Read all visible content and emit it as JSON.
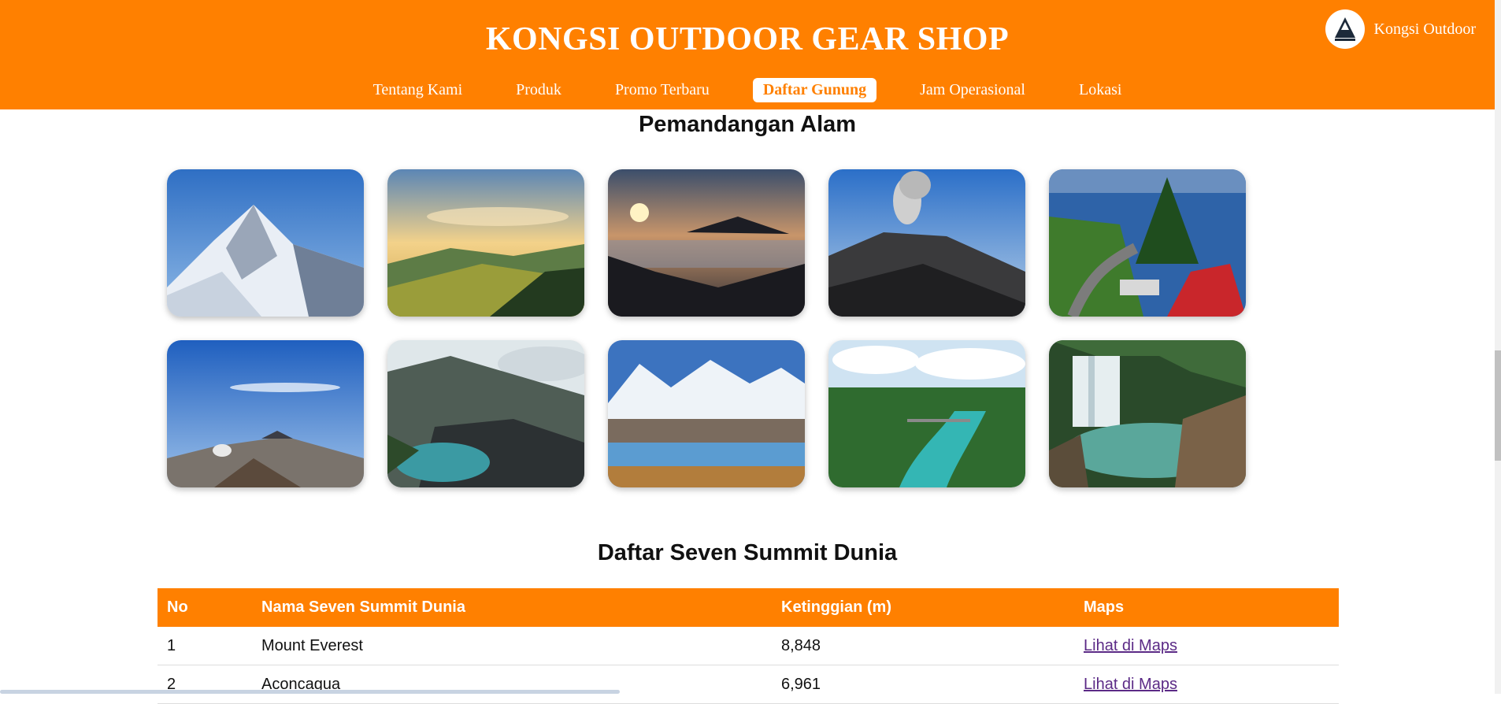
{
  "header": {
    "title": "KONGSI OUTDOOR GEAR SHOP",
    "nav": [
      {
        "label": "Tentang Kami",
        "active": false
      },
      {
        "label": "Produk",
        "active": false
      },
      {
        "label": "Promo Terbaru",
        "active": false
      },
      {
        "label": "Daftar Gunung",
        "active": true
      },
      {
        "label": "Jam Operasional",
        "active": false
      },
      {
        "label": "Lokasi",
        "active": false
      }
    ],
    "brand": {
      "name": "Kongsi Outdoor",
      "logo_icon": "mountain-logo-icon"
    }
  },
  "gallery": {
    "title": "Pemandangan Alam",
    "photos": [
      {
        "name": "snowy-peak-photo"
      },
      {
        "name": "sunrise-hills-photo"
      },
      {
        "name": "sunset-mountain-photo"
      },
      {
        "name": "volcano-smoke-photo"
      },
      {
        "name": "lake-road-photo"
      },
      {
        "name": "bromo-photo"
      },
      {
        "name": "crater-lake-photo"
      },
      {
        "name": "snow-range-lake-photo"
      },
      {
        "name": "tropical-river-photo"
      },
      {
        "name": "waterfall-photo"
      }
    ]
  },
  "summits": {
    "title": "Daftar Seven Summit Dunia",
    "columns": [
      "No",
      "Nama Seven Summit Dunia",
      "Ketinggian (m)",
      "Maps"
    ],
    "rows": [
      {
        "no": "1",
        "name": "Mount Everest",
        "height": "8,848",
        "maps": "Lihat di Maps"
      },
      {
        "no": "2",
        "name": "Aconcagua",
        "height": "6,961",
        "maps": "Lihat di Maps"
      }
    ]
  },
  "colors": {
    "accent": "#ff8000",
    "link": "#5b2a86"
  }
}
